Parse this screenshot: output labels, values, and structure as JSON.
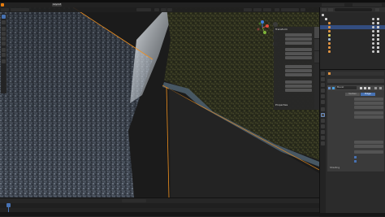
{
  "window": {
    "title": ""
  },
  "menubar": {
    "items": [
      {
        "label": ""
      },
      {
        "label": ""
      },
      {
        "label": ""
      },
      {
        "label": ""
      },
      {
        "label": ""
      },
      {
        "label": ""
      },
      {
        "label": ""
      }
    ],
    "workspaces": [
      {
        "label": "Layout",
        "active": true
      },
      {
        "label": "",
        "active": false
      },
      {
        "label": "",
        "active": false
      },
      {
        "label": "",
        "active": false
      },
      {
        "label": "",
        "active": false
      },
      {
        "label": "",
        "active": false
      },
      {
        "label": "",
        "active": false
      },
      {
        "label": "",
        "active": false
      },
      {
        "label": "",
        "active": false
      },
      {
        "label": "",
        "active": false
      }
    ],
    "scene": "",
    "view_layer": ""
  },
  "viewport": {
    "header": {
      "mode": "",
      "menus": [
        "",
        "",
        "",
        "",
        ""
      ],
      "transform_orientation": ""
    },
    "overlay_text": {
      "view_name": "",
      "object_name": "",
      "stats": [
        "",
        "",
        "",
        ""
      ]
    },
    "gizmo_axes": {
      "x": "X",
      "y": "Y",
      "z": "Z"
    },
    "axis_colors": {
      "x": "#e74c3c",
      "y": "#7fb53a",
      "z": "#3f7fe0"
    },
    "n_panel": {
      "transform_header": "Transform",
      "location_values": [
        "",
        "",
        ""
      ],
      "rotation_values": [
        "",
        "",
        ""
      ],
      "scale_values": [
        "",
        "",
        ""
      ],
      "dimension_values": [
        "",
        "",
        ""
      ],
      "properties_header": "Properties",
      "tabs": [
        "",
        "",
        ""
      ]
    }
  },
  "timeline": {
    "header_items": [
      "",
      "",
      "",
      ""
    ],
    "frame_numbers": [
      "",
      "",
      "",
      "",
      "",
      "",
      "",
      "",
      "",
      ""
    ],
    "current_frame": "",
    "start_frame": "",
    "end_frame": ""
  },
  "statusbar": {
    "hints": [
      "",
      ""
    ],
    "version": ""
  },
  "outliner": {
    "search_placeholder": "",
    "rows": [
      {
        "name": "",
        "icon": "scene-collection-icon",
        "indent": 0,
        "selected": false
      },
      {
        "name": "",
        "icon": "collection-icon",
        "indent": 1,
        "selected": false
      },
      {
        "name": "",
        "icon": "mesh-object-icon",
        "indent": 2,
        "selected": false
      },
      {
        "name": "",
        "icon": "mesh-object-icon",
        "indent": 2,
        "selected": true
      },
      {
        "name": "",
        "icon": "mesh-object-icon",
        "indent": 2,
        "selected": false
      },
      {
        "name": "",
        "icon": "light-icon",
        "indent": 2,
        "selected": false
      },
      {
        "name": "",
        "icon": "camera-icon",
        "indent": 2,
        "selected": false
      },
      {
        "name": "",
        "icon": "mesh-object-icon",
        "indent": 2,
        "selected": false
      },
      {
        "name": "",
        "icon": "mesh-object-icon",
        "indent": 2,
        "selected": false
      },
      {
        "name": "",
        "icon": "mesh-object-icon",
        "indent": 2,
        "selected": false
      }
    ]
  },
  "properties": {
    "object_name": "",
    "add_modifier": "",
    "modifier": {
      "name": "Bevel",
      "affect_options": [
        "Vertex",
        "Edge"
      ],
      "affect_selected": "Edge",
      "fields": [
        {
          "label": "",
          "value": ""
        },
        {
          "label": "",
          "value": ""
        },
        {
          "label": "",
          "value": ""
        },
        {
          "label": "",
          "value": ""
        },
        {
          "label": "",
          "value": ""
        }
      ],
      "sections": [
        "",
        "",
        ""
      ],
      "shading_fields": [
        {
          "label": "",
          "value": ""
        },
        {
          "label": "",
          "value": ""
        },
        {
          "label": "",
          "value": ""
        }
      ],
      "checkboxes": [
        {
          "label": "",
          "checked": true
        },
        {
          "label": "",
          "checked": true
        }
      ],
      "footer_section": "Shading"
    }
  },
  "colors": {
    "accent": "#4772b3",
    "selection_outline": "#f0901e",
    "active_row": "#334d80"
  }
}
